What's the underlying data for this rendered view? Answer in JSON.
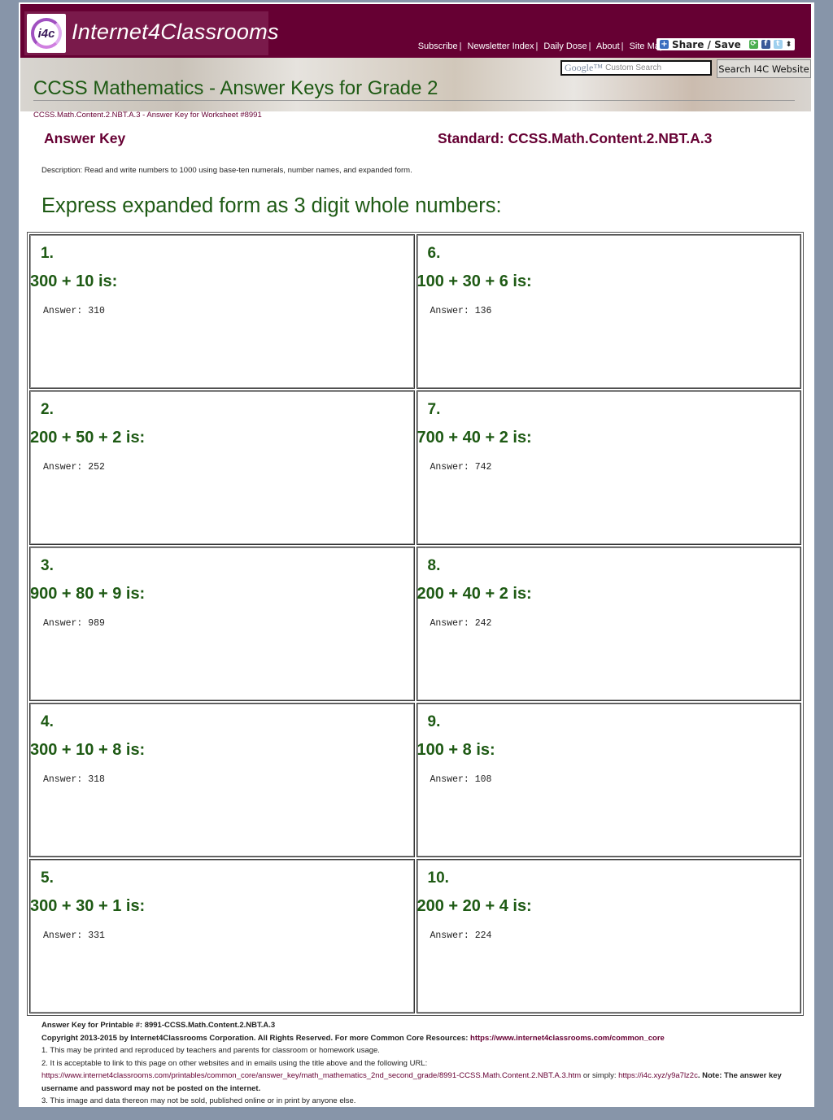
{
  "header": {
    "logo_mark": "i4c",
    "site_name": "Internet4Classrooms",
    "nav": [
      "Subscribe",
      "Newsletter Index",
      "Daily Dose",
      "About",
      "Site Map"
    ],
    "share_label": "Share / Save",
    "search_placeholder": "Custom Search",
    "search_brand": "Google™",
    "search_button": "Search I4C Website",
    "page_title": "CCSS Mathematics - Answer Keys for Grade 2"
  },
  "breadcrumb": "CCSS.Math.Content.2.NBT.A.3 - Answer Key for Worksheet #8991",
  "answer_key_label": "Answer Key",
  "standard_label": "Standard: CCSS.Math.Content.2.NBT.A.3",
  "description": "Description: Read and write numbers to 1000 using base-ten numerals, number names, and expanded form.",
  "instructions": "Express expanded form as 3 digit whole numbers:",
  "questions": [
    {
      "num": "1.",
      "text": "300 + 10 is:",
      "answer": "Answer: 310"
    },
    {
      "num": "6.",
      "text": "100 + 30 + 6 is:",
      "answer": "Answer: 136"
    },
    {
      "num": "2.",
      "text": "200 + 50 + 2 is:",
      "answer": "Answer: 252"
    },
    {
      "num": "7.",
      "text": "700 + 40 + 2 is:",
      "answer": "Answer: 742"
    },
    {
      "num": "3.",
      "text": "900 + 80 + 9 is:",
      "answer": "Answer: 989"
    },
    {
      "num": "8.",
      "text": "200 + 40 + 2 is:",
      "answer": "Answer: 242"
    },
    {
      "num": "4.",
      "text": "300 + 10 + 8 is:",
      "answer": "Answer: 318"
    },
    {
      "num": "9.",
      "text": "100 + 8 is:",
      "answer": "Answer: 108"
    },
    {
      "num": "5.",
      "text": "300 + 30 + 1 is:",
      "answer": "Answer: 331"
    },
    {
      "num": "10.",
      "text": "200 + 20 + 4 is:",
      "answer": "Answer: 224"
    }
  ],
  "footer": {
    "printable": "Answer Key for Printable #: 8991-CCSS.Math.Content.2.NBT.A.3",
    "copyright": "Copyright 2013-2015 by Internet4Classrooms Corporation. All Rights Reserved. For more Common Core Resources: ",
    "copyright_link": "https://www.internet4classrooms.com/common_core",
    "note1": "1. This may be printed and reproduced by teachers and parents for classroom or homework usage.",
    "note2": "2. It is acceptable to link to this page on other websites and in emails using the title above and the following URL:",
    "long_url": "https://www.internet4classrooms.com/printables/common_core/answer_key/math_mathematics_2nd_second_grade/8991-CCSS.Math.Content.2.NBT.A.3.htm",
    "or_simply": " or simply: ",
    "short_url": "https://i4c.xyz/y9a7lz2c",
    "note_warning": ". Note: The answer key username and password may not be posted on the internet.",
    "note3": "3. This image and data thereon may not be sold, published online or in print by anyone else."
  }
}
